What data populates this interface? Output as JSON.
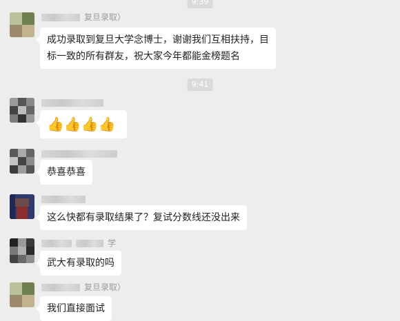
{
  "timestamps": [
    "9:39",
    "9:41"
  ],
  "messages": [
    {
      "nick": "复旦录取）",
      "text_line1": "成功录取到复旦大学念博士，谢谢我们互相扶持，目",
      "text_line2": "标一致的所有群友，祝大家今年都能金榜题名"
    },
    {
      "reaction": "👍👍👍👍"
    },
    {
      "text": "恭喜恭喜"
    },
    {
      "text": "这么快都有录取结果了？复试分数线还没出来"
    },
    {
      "nick_suffix": "学",
      "text": "武大有录取的吗"
    },
    {
      "nick": "复旦录取）",
      "text": "我们直接面试"
    }
  ],
  "colors": {
    "background": "#ededed",
    "bubble": "#ffffff",
    "timestamp_bg": "#dadada"
  },
  "icons": [
    "thumbs-up-icon"
  ]
}
